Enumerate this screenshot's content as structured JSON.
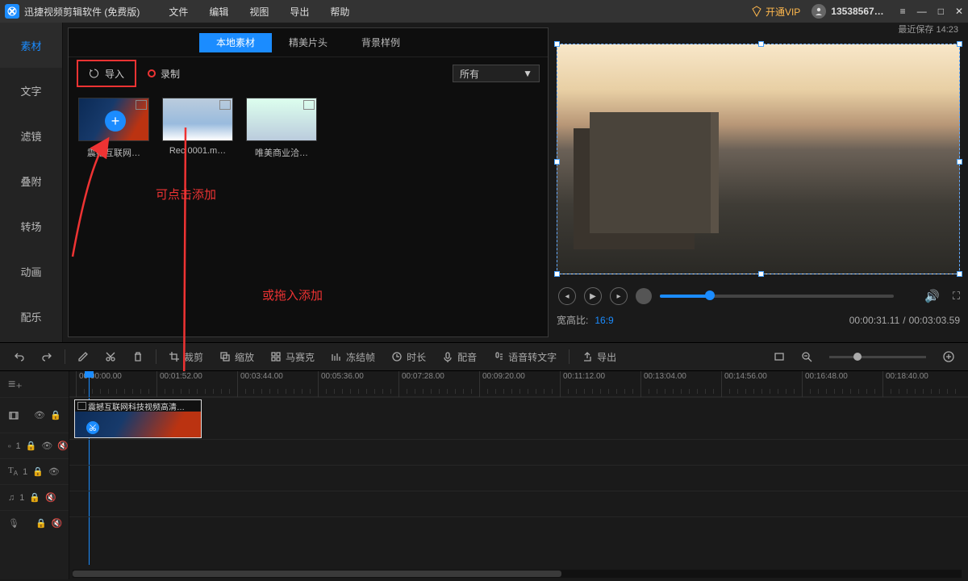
{
  "titlebar": {
    "app_name": "迅捷视频剪辑软件 (免费版)",
    "menus": [
      "文件",
      "编辑",
      "视图",
      "导出",
      "帮助"
    ],
    "vip_label": "开通VIP",
    "username": "13538567…"
  },
  "save_indicator": "最近保存 14:23",
  "sidetabs": [
    "素材",
    "文字",
    "滤镜",
    "叠附",
    "转场",
    "动画",
    "配乐"
  ],
  "media": {
    "tabs": [
      "本地素材",
      "精美片头",
      "背景样例"
    ],
    "import_label": "导入",
    "record_label": "录制",
    "filter_selected": "所有",
    "thumbs": [
      {
        "caption": "震撼互联网…"
      },
      {
        "caption": "Rec 0001.m…"
      },
      {
        "caption": "唯美商业洽…"
      }
    ]
  },
  "annotations": {
    "click_add": "可点击添加",
    "drag_add": "或拖入添加"
  },
  "preview": {
    "aspect_label": "宽高比:",
    "aspect_value": "16:9",
    "time_current": "00:00:31.11",
    "time_total": "00:03:03.59"
  },
  "toolbar": {
    "crop": "裁剪",
    "zoom": "缩放",
    "mosaic": "马赛克",
    "freeze": "冻结帧",
    "duration": "时长",
    "dub": "配音",
    "stt": "语音转文字",
    "export": "导出"
  },
  "timeline": {
    "ticks": [
      "00:00:00.00",
      "00:01:52.00",
      "00:03:44.00",
      "00:05:36.00",
      "00:07:28.00",
      "00:09:20.00",
      "00:11:12.00",
      "00:13:04.00",
      "00:14:56.00",
      "00:16:48.00",
      "00:18:40.00"
    ],
    "clip_title": "震撼互联网科技视频高清…",
    "track_index": "1"
  }
}
